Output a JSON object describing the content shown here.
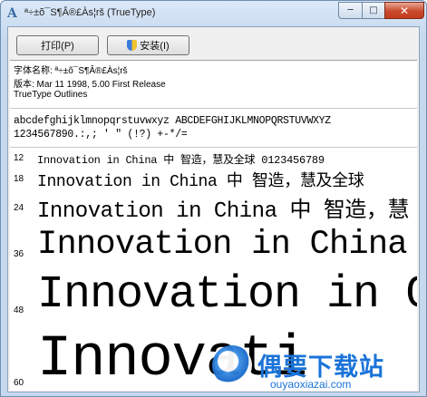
{
  "window": {
    "title": "ª÷±õ¯S¶Â®£Às¦rš (TrueType)",
    "minimize_glyph": "─",
    "maximize_glyph": "□",
    "close_glyph": "✕"
  },
  "toolbar": {
    "print_label": "打印(P)",
    "install_label": "安装(I)"
  },
  "font_info": {
    "name_line": "字体名称: ª÷±õ¯S¶Â®£Às¦rš",
    "version_line": "版本: Mar 11 1998, 5.00 First Release",
    "type_line": "TrueType Outlines"
  },
  "charset": {
    "line1": "abcdefghijklmnopqrstuvwxyz ABCDEFGHIJKLMNOPQRSTUVWXYZ",
    "line2": "1234567890.:,; ' \" (!?) +-*/="
  },
  "samples": [
    {
      "size": "12",
      "text": "Innovation in China 中 智造，慧及全球 0123456789"
    },
    {
      "size": "18",
      "text": "Innovation in China 中 智造，慧及全球"
    },
    {
      "size": "24",
      "text": "Innovation in China 中 智造，慧"
    },
    {
      "size": "36",
      "text": "Innovation in China"
    },
    {
      "size": "48",
      "text": "Innovation in C"
    },
    {
      "size": "60",
      "text": "Innovati"
    }
  ],
  "watermark": {
    "title": "偶要下载站",
    "url": "ouyaoxiazai.com"
  }
}
